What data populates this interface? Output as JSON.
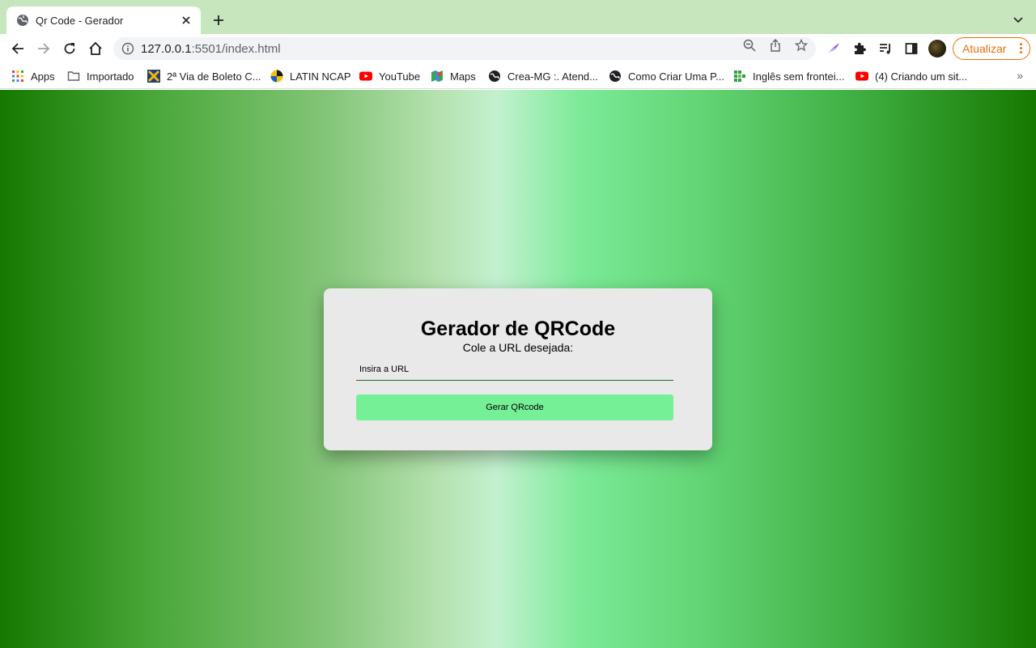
{
  "tab": {
    "title": "Qr Code - Gerador"
  },
  "address_bar": {
    "host": "127.0.0.1",
    "path": ":5501/index.html"
  },
  "toolbar": {
    "update_label": "Atualizar"
  },
  "bookmarks": [
    {
      "label": "Apps",
      "icon": "apps-grid-icon"
    },
    {
      "label": "Importado",
      "icon": "folder-icon"
    },
    {
      "label": "2ª Via de Boleto C...",
      "icon": "boleto-icon"
    },
    {
      "label": "LATIN NCAP",
      "icon": "latin-ncap-icon"
    },
    {
      "label": "YouTube",
      "icon": "youtube-icon"
    },
    {
      "label": "Maps",
      "icon": "maps-icon"
    },
    {
      "label": "Crea-MG :. Atend...",
      "icon": "globe-icon"
    },
    {
      "label": "Como Criar Uma P...",
      "icon": "globe-icon"
    },
    {
      "label": "Inglês sem frontei...",
      "icon": "ingles-icon"
    },
    {
      "label": "(4) Criando um sit...",
      "icon": "youtube-icon"
    }
  ],
  "page": {
    "title": "Gerador de QRCode",
    "subtitle": "Cole a URL desejada:",
    "input_placeholder": "Insira a URL",
    "button_label": "Gerar QRcode"
  },
  "colors": {
    "tabstrip": "#c8e6bd",
    "card": "#e9e9e9",
    "button": "#76f096",
    "accent_update": "#e8710a"
  }
}
